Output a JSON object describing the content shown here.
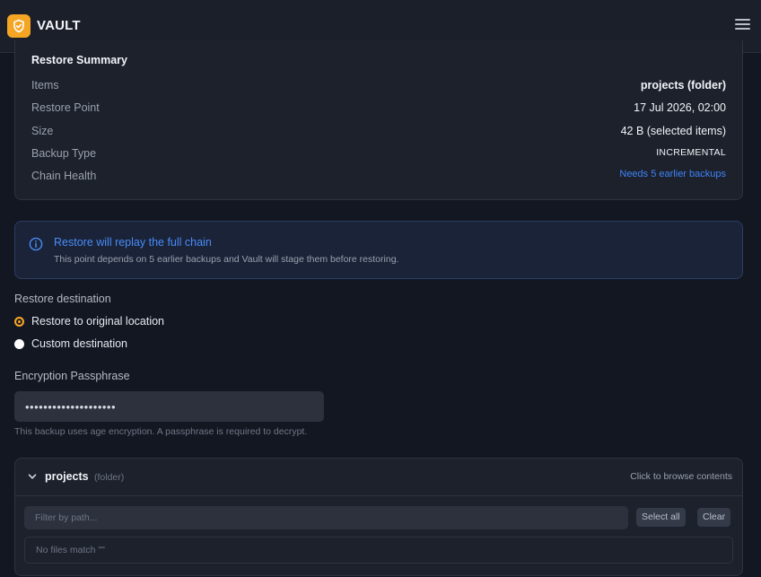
{
  "app": {
    "brand": "VAULT"
  },
  "summary": {
    "title": "Restore Summary",
    "rows": [
      {
        "label": "Items",
        "value": "projects (folder)"
      },
      {
        "label": "Restore Point",
        "value": "17 Jul 2026, 02:00"
      },
      {
        "label": "Size",
        "value": "42 B (selected items)"
      },
      {
        "label": "Backup Type",
        "value": "INCREMENTAL"
      },
      {
        "label": "Chain Health",
        "value": "Needs 5 earlier backups"
      }
    ]
  },
  "info": {
    "title": "Restore will replay the full chain",
    "text": "This point depends on 5 earlier backups and Vault will stage them before restoring."
  },
  "destination": {
    "label": "Restore destination",
    "options": [
      {
        "label": "Restore to original location",
        "selected": true
      },
      {
        "label": "Custom destination",
        "selected": false
      }
    ]
  },
  "passphrase": {
    "label": "Encryption Passphrase",
    "value": "••••••••••••••••••••",
    "help": "This backup uses age encryption. A passphrase is required to decrypt."
  },
  "folder": {
    "name": "projects",
    "type": "(folder)",
    "hint": "Click to browse contents",
    "filter_placeholder": "Filter by path...",
    "select_all_label": "Select all",
    "clear_label": "Clear",
    "empty_text": "No files match \"\""
  },
  "colors": {
    "accent": "#f5a524",
    "link": "#3f83f8",
    "background": "#131722",
    "card": "#1c212c"
  },
  "icons": [
    "shield-check-icon",
    "hamburger-menu-icon",
    "info-circle-icon",
    "chevron-down-icon"
  ]
}
